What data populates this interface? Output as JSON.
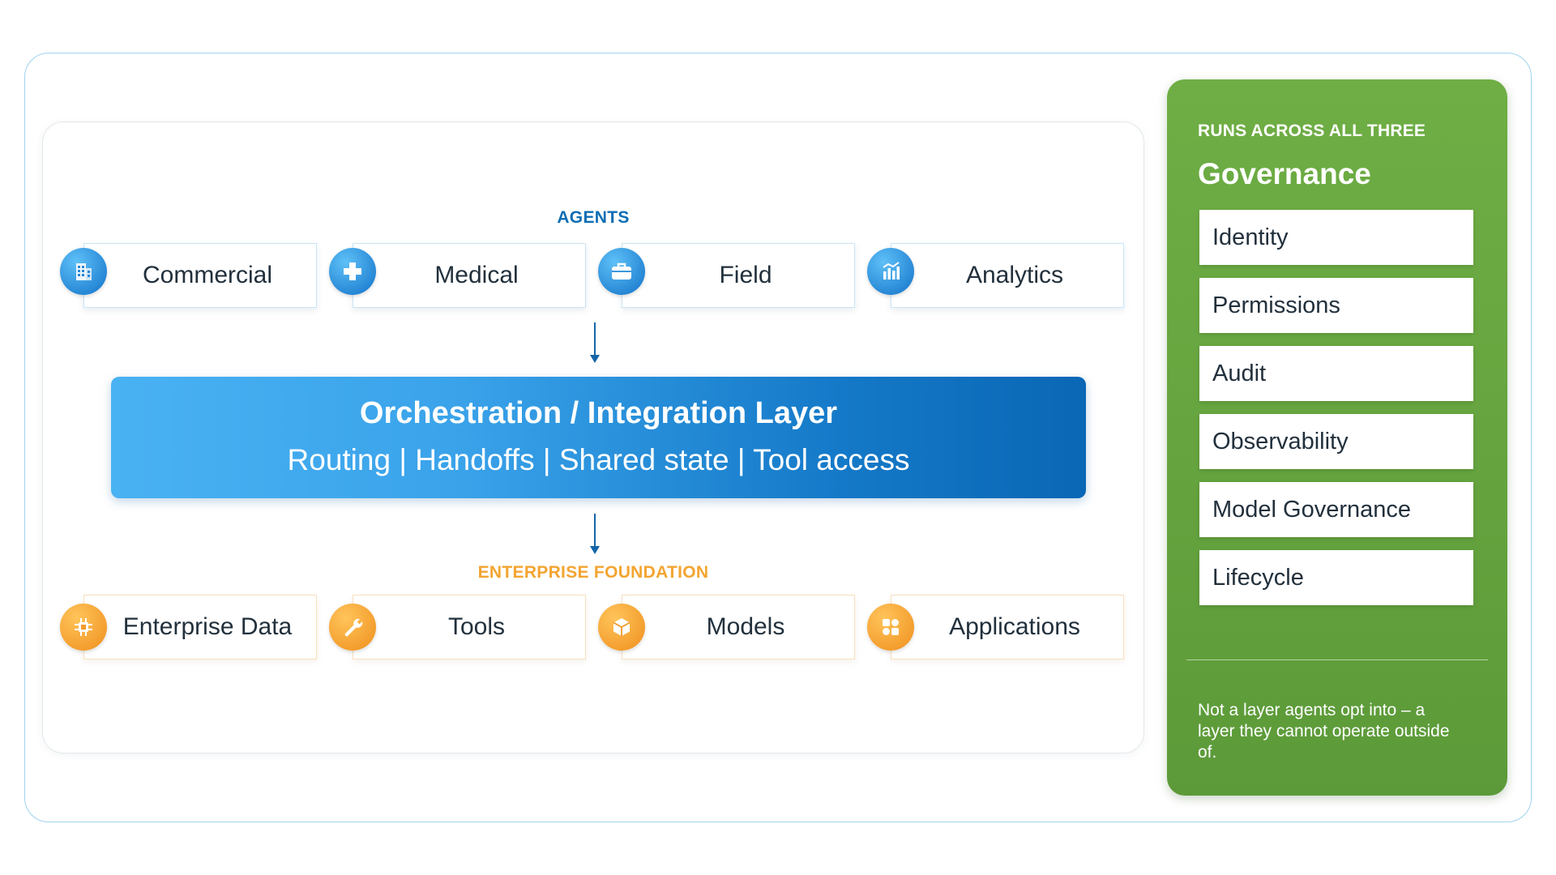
{
  "agents": {
    "label": "AGENTS",
    "items": [
      {
        "label": "Commercial",
        "icon": "building-icon"
      },
      {
        "label": "Medical",
        "icon": "medical-cross-icon"
      },
      {
        "label": "Field",
        "icon": "briefcase-icon"
      },
      {
        "label": "Analytics",
        "icon": "analytics-chart-icon"
      }
    ]
  },
  "orchestration": {
    "title": "Orchestration / Integration Layer",
    "subtitle": "Routing | Handoffs | Shared state | Tool access"
  },
  "foundation": {
    "label": "ENTERPRISE FOUNDATION",
    "items": [
      {
        "label": "Enterprise Data",
        "icon": "data-chip-icon"
      },
      {
        "label": "Tools",
        "icon": "wrench-icon"
      },
      {
        "label": "Models",
        "icon": "cube-icon"
      },
      {
        "label": "Applications",
        "icon": "app-grid-icon"
      }
    ]
  },
  "governance": {
    "kicker": "RUNS ACROSS ALL THREE",
    "title": "Governance",
    "items": [
      "Identity",
      "Permissions",
      "Audit",
      "Observability",
      "Model Governance",
      "Lifecycle"
    ],
    "note": "Not a layer agents opt into – a layer they cannot operate outside of."
  },
  "colors": {
    "agents_accent": "#0d6db4",
    "foundation_accent": "#f3a531",
    "governance_green": "#6fae45",
    "orchestration_blue": "#1479c8"
  }
}
